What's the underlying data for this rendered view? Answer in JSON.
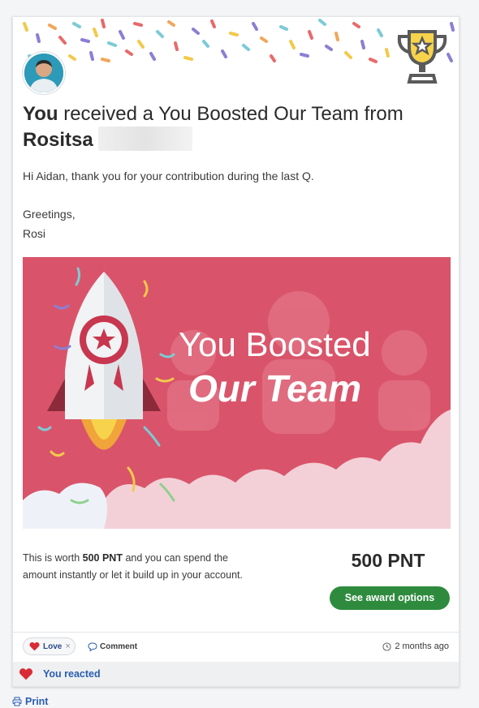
{
  "post": {
    "title_you": "You",
    "title_middle": " received a You Boosted Our Team from ",
    "sender_first_name": "Rositsa",
    "message_line1": "Hi Aidan, thank you for your contribution during the last Q.",
    "message_line2": "Greetings,",
    "message_line3": "Rosi"
  },
  "banner": {
    "line1": "You Boosted",
    "line2": "Our Team",
    "background_color": "#d9546a"
  },
  "award": {
    "worth_prefix": "This is worth ",
    "worth_amount": "500 PNT",
    "worth_suffix": " and you can spend the amount instantly or let it build up in your account.",
    "points_display": "500 PNT",
    "button_label": "See award options",
    "button_color": "#2e8b3e"
  },
  "reactions": {
    "love_label": "Love",
    "comment_label": "Comment",
    "time_label": "2 months ago",
    "reacted_label": "You reacted"
  },
  "footer": {
    "print_label": "Print"
  },
  "icons": [
    "trophy-icon",
    "heart-icon",
    "close-icon",
    "comment-icon",
    "clock-icon",
    "printer-icon"
  ]
}
